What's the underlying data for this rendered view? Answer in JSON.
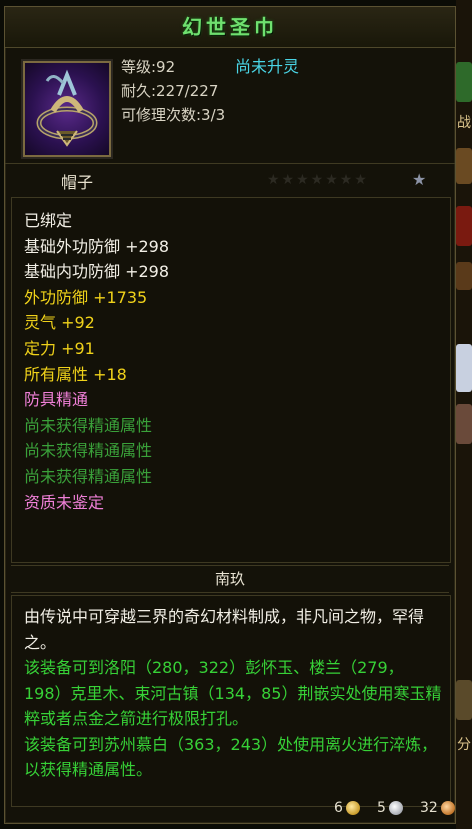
{
  "item": {
    "name": "幻世圣巾",
    "icon": "helmet-headband-icon",
    "stats": [
      "等级:92",
      "耐久:227/227",
      "可修理次数:3/3"
    ],
    "spirit_status": "尚未升灵",
    "type": "帽子",
    "stars_empty": "★★★★★★★",
    "star_lit": "★"
  },
  "attributes": [
    {
      "text": "已绑定",
      "color": "white"
    },
    {
      "text": "基础外功防御 +298",
      "color": "white"
    },
    {
      "text": "基础内功防御 +298",
      "color": "white"
    },
    {
      "text": "外功防御 +1735",
      "color": "yellow"
    },
    {
      "text": "灵气 +92",
      "color": "yellow"
    },
    {
      "text": "定力 +91",
      "color": "yellow"
    },
    {
      "text": "所有属性 +18",
      "color": "yellow"
    },
    {
      "text": "防具精通",
      "color": "pink"
    },
    {
      "text": "尚未获得精通属性",
      "color": "green"
    },
    {
      "text": "尚未获得精通属性",
      "color": "green"
    },
    {
      "text": "尚未获得精通属性",
      "color": "green"
    },
    {
      "text": "资质未鉴定",
      "color": "pink"
    }
  ],
  "origin": "南玖",
  "description": [
    {
      "text": "由传说中可穿越三界的奇幻材料制成，非凡间之物，罕得之。",
      "color": "white"
    },
    {
      "text": "该装备可到洛阳（280，322）彭怀玉、楼兰（279，198）克里木、束河古镇（134，85）荆嵌实处使用寒玉精粹或者点金之箭进行极限打孔。",
      "color": "green"
    },
    {
      "text": "该装备可到苏州慕白（363，243）处使用离火进行淬炼，以获得精通属性。",
      "color": "green"
    }
  ],
  "currency": {
    "gold": "6",
    "silver": "5",
    "copper": "32"
  },
  "side": {
    "label_a": "战",
    "label_b": "分"
  },
  "colors": {
    "title": "#6fe06f",
    "yellow": "#f0d21a",
    "pink": "#f080d8",
    "green": "#37d137",
    "cyan": "#4ad5e6"
  }
}
